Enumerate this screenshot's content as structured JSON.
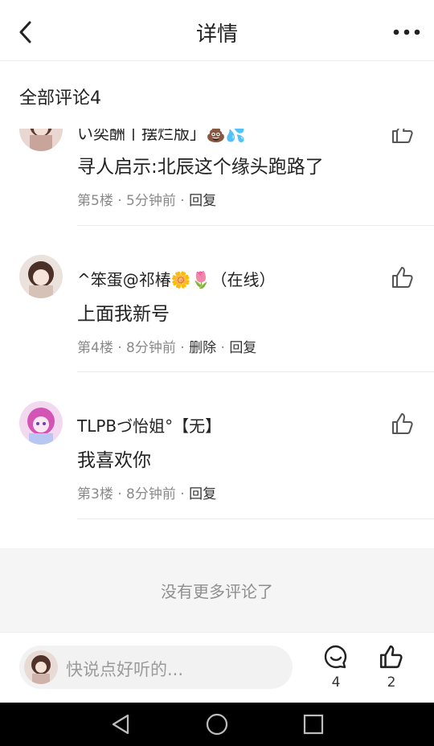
{
  "header": {
    "title": "详情",
    "back_icon": "chevron-left-icon",
    "more_icon": "more-dots-icon"
  },
  "section": {
    "title": "全部评论4"
  },
  "comments": [
    {
      "nick": "い奕酬丨摆烂版」💩💦",
      "content": "寻人启示:北辰这个缘头跑路了",
      "floor": "第5楼",
      "time": "5分钟前",
      "actions": [
        "回复"
      ]
    },
    {
      "nick": "^笨蛋@祁椿🌼🌷（在线）",
      "content": "上面我新号",
      "floor": "第4楼",
      "time": "8分钟前",
      "actions": [
        "删除",
        "回复"
      ]
    },
    {
      "nick": "TLPBづ怡姐°【无】",
      "content": "我喜欢你",
      "floor": "第3楼",
      "time": "8分钟前",
      "actions": [
        "回复"
      ]
    }
  ],
  "meta_dot": "·",
  "footer_note": "没有更多评论了",
  "composer": {
    "placeholder": "快说点好听的..."
  },
  "stats": {
    "comments": "4",
    "likes": "2"
  },
  "colors": {
    "text": "#222222",
    "meta": "#8a8a8a",
    "divider": "#e9e9e9",
    "footer_bg": "#f5f5f5"
  }
}
